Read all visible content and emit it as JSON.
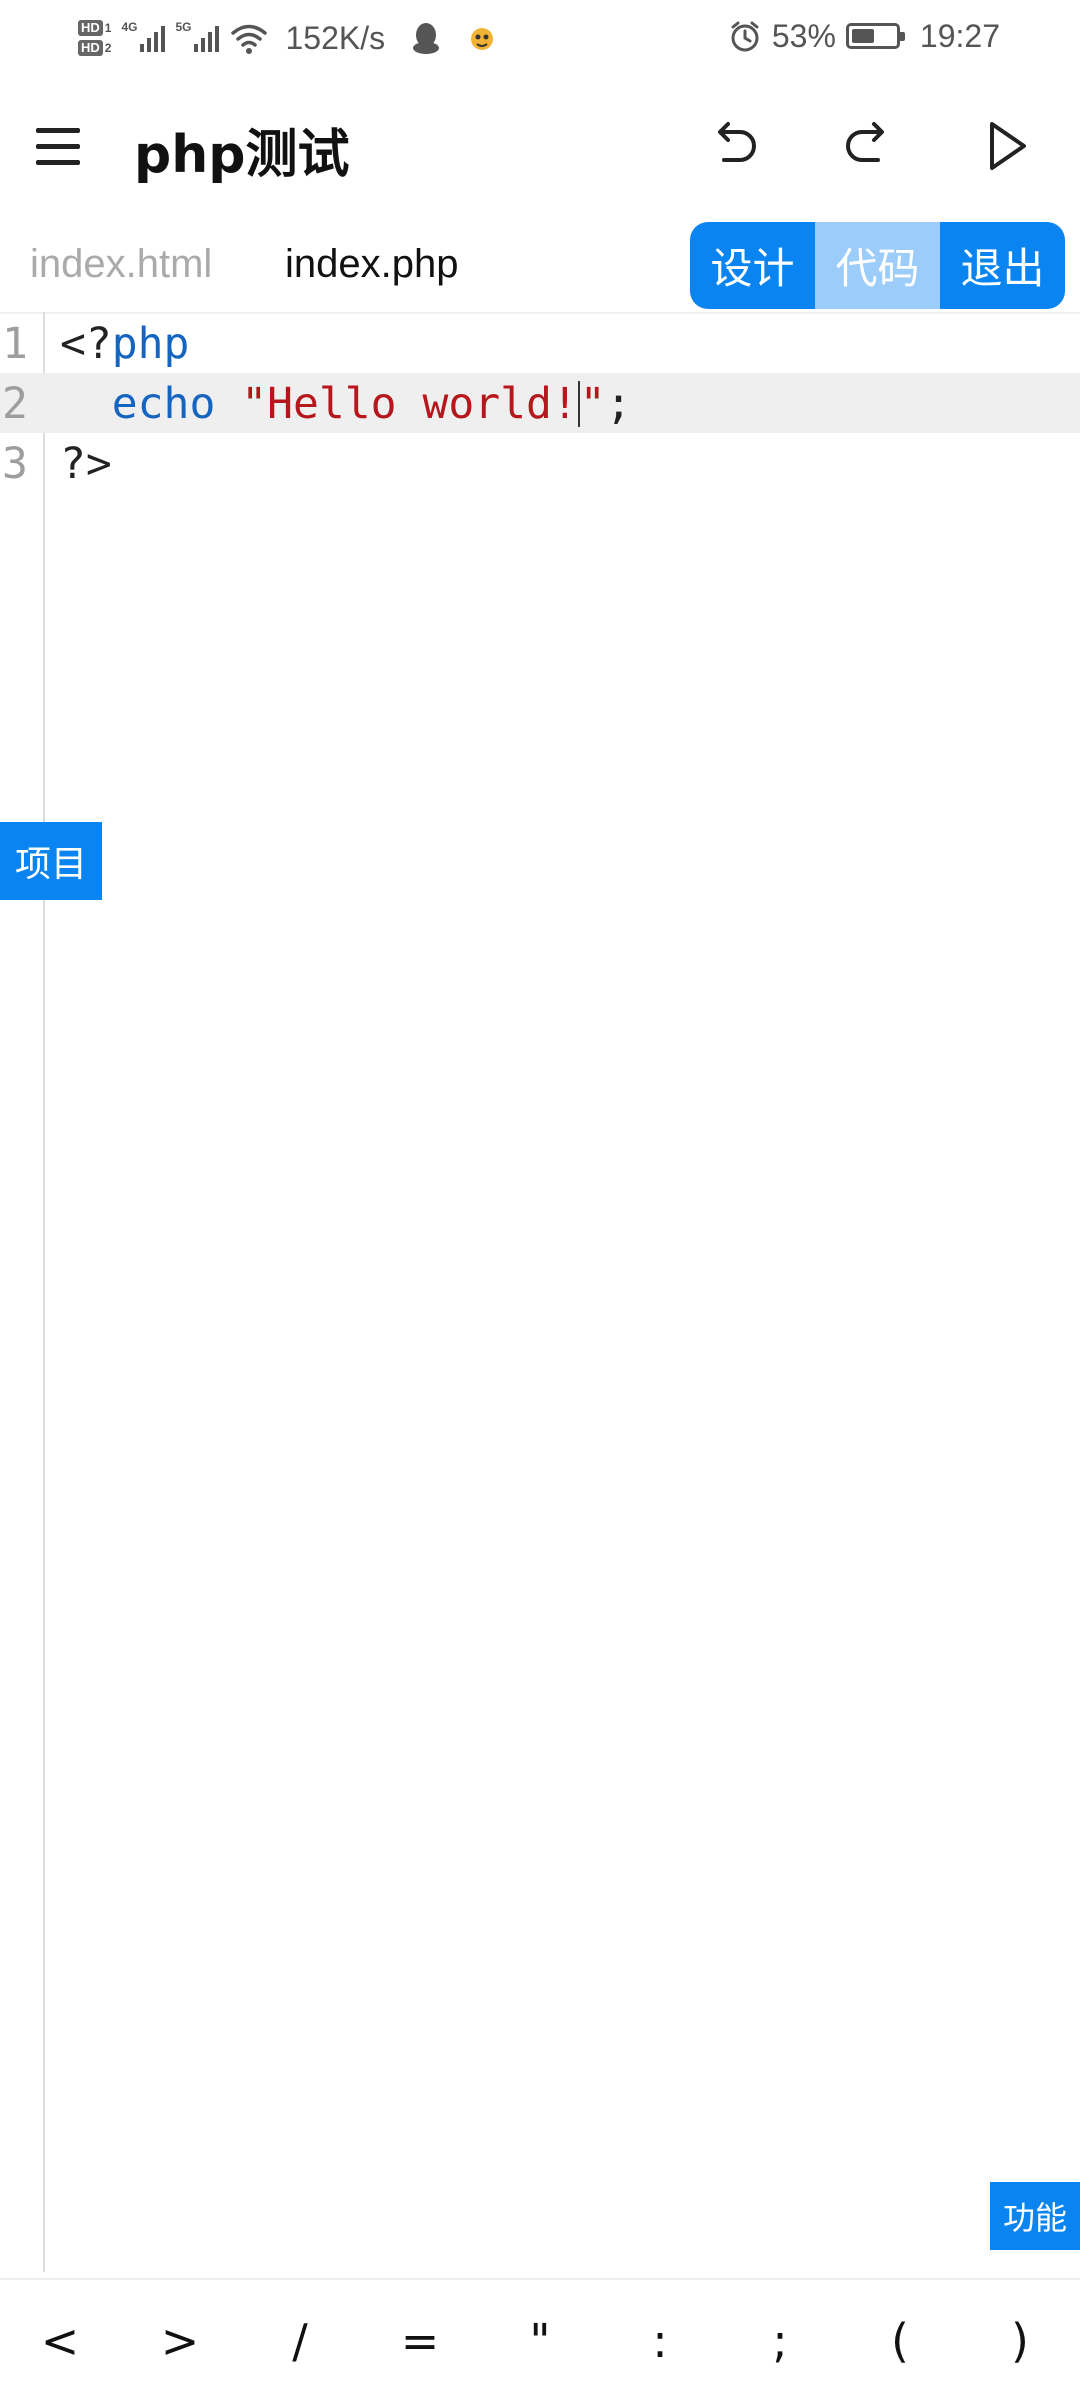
{
  "status_bar": {
    "hd1": "HD",
    "hd1_sub": "1",
    "hd2": "HD",
    "hd2_sub": "2",
    "net1": "4G",
    "net2": "5G",
    "speed": "152K/s",
    "battery_percent": "53%",
    "battery_level": 0.53,
    "time": "19:27",
    "icons": [
      "alarm-icon",
      "wifi-icon",
      "signal-icon",
      "qq-icon",
      "app-icon",
      "battery-icon"
    ]
  },
  "toolbar": {
    "title": "php测试",
    "icons": [
      "menu-icon",
      "undo-icon",
      "redo-icon",
      "run-icon"
    ]
  },
  "tabs": {
    "files": [
      {
        "label": "index.html",
        "active": false
      },
      {
        "label": "index.php",
        "active": true
      }
    ],
    "modes": [
      {
        "label": "设计",
        "selected": false
      },
      {
        "label": "代码",
        "selected": true
      },
      {
        "label": "退出",
        "selected": false
      }
    ]
  },
  "editor": {
    "lines": [
      {
        "number": "1",
        "parts": [
          {
            "text": "<?",
            "kind": "plain"
          },
          {
            "text": "php",
            "kind": "keyword"
          }
        ]
      },
      {
        "number": "2",
        "parts": [
          {
            "text": "  ",
            "kind": "plain"
          },
          {
            "text": "echo",
            "kind": "keyword"
          },
          {
            "text": " ",
            "kind": "plain"
          },
          {
            "text": "\"Hello world!",
            "kind": "string"
          },
          {
            "text": "caret",
            "kind": "caret"
          },
          {
            "text": "\"",
            "kind": "string"
          },
          {
            "text": ";",
            "kind": "plain"
          }
        ]
      },
      {
        "number": "3",
        "parts": [
          {
            "text": "?>",
            "kind": "plain"
          }
        ]
      }
    ],
    "highlighted_line": "2"
  },
  "floating": {
    "projects_label": "项目",
    "functions_label": "功能"
  },
  "symbol_bar": {
    "symbols": [
      "<",
      ">",
      "/",
      "=",
      "\"",
      ":",
      ";",
      "(",
      ")"
    ]
  },
  "colors": {
    "accent": "#0a84f0",
    "accent_selected": "#9ccdfa",
    "keyword": "#1565c0",
    "string": "#b5171c"
  }
}
